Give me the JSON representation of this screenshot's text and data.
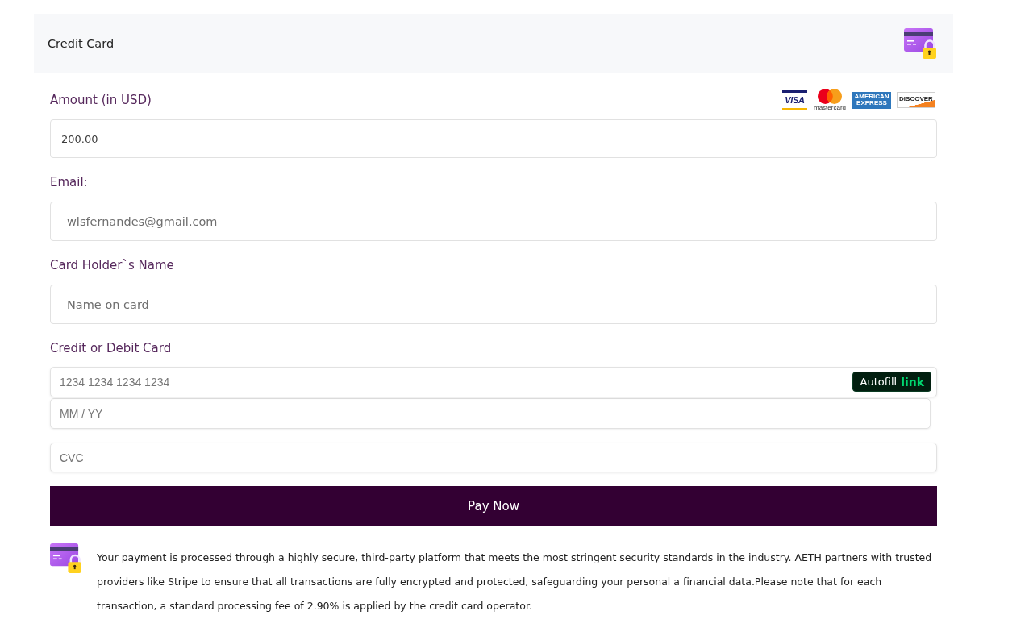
{
  "header": {
    "title": "Credit Card"
  },
  "card_brands": [
    {
      "kind": "visa",
      "text": "VISA"
    },
    {
      "kind": "mastercard",
      "text": "mastercard"
    },
    {
      "kind": "amex",
      "text": "AMERICAN EXPRESS"
    },
    {
      "kind": "discover",
      "text": "DISCOVER"
    }
  ],
  "fields": [
    {
      "kind": "amount",
      "label": "Amount (in USD)",
      "value": "200.00"
    },
    {
      "kind": "email",
      "label": "Email:",
      "value": "wlsfernandes@gmail.com"
    },
    {
      "kind": "text",
      "label": "Card Holder`s Name",
      "placeholder": "Name on card"
    }
  ],
  "card_element": {
    "label": "Credit or Debit Card",
    "number_placeholder": "1234 1234 1234 1234",
    "autofill": {
      "label": "Autofill",
      "brand": "link"
    },
    "expiry_placeholder": "MM / YY",
    "cvc_placeholder": "CVC"
  },
  "pay_button": {
    "label": "Pay Now"
  },
  "notice": {
    "text": "Your payment is processed through a highly secure, third-party platform that meets the most stringent security standards in the industry. AETH partners with trusted providers like Stripe to ensure that all transactions are fully encrypted and protected, safeguarding your personal a financial data.Please note that for each transaction, a standard processing fee of 2.90% is applied by the credit card operator."
  }
}
